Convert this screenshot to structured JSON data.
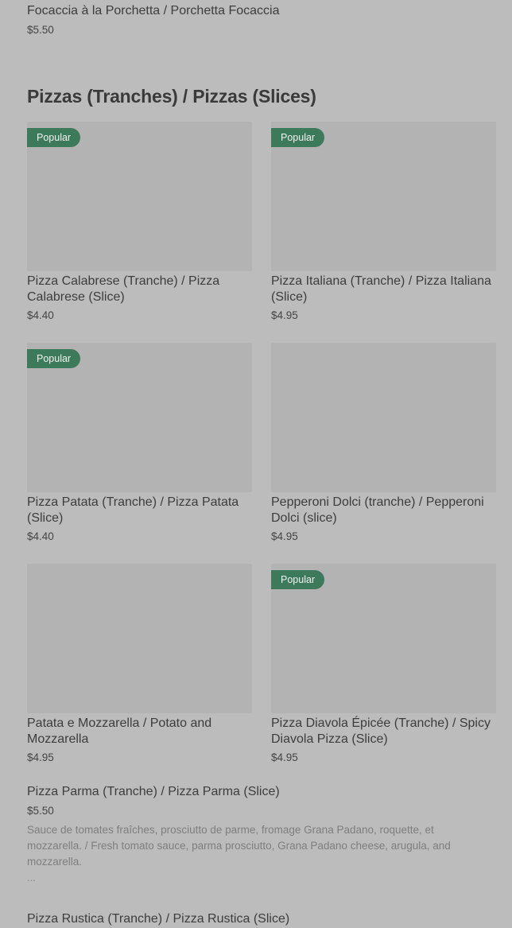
{
  "top_item": {
    "name": "Focaccia à la Porchetta / Porchetta Focaccia",
    "price": "$5.50"
  },
  "section": {
    "title": "Pizzas (Tranches) / Pizzas (Slices)"
  },
  "cards": [
    {
      "badge": "Popular",
      "name": "Pizza Calabrese (Tranche) / Pizza Calabrese (Slice)",
      "price": "$4.40"
    },
    {
      "badge": "Popular",
      "name": "Pizza Italiana  (Tranche) / Pizza Italiana (Slice)",
      "price": "$4.95"
    },
    {
      "badge": "Popular",
      "name": "Pizza Patata (Tranche) / Pizza Patata (Slice)",
      "price": "$4.40"
    },
    {
      "badge": "",
      "name": "Pepperoni Dolci (tranche) / Pepperoni Dolci (slice)",
      "price": "$4.95"
    },
    {
      "badge": "",
      "name": "Patata e Mozzarella / Potato and Mozzarella",
      "price": "$4.95"
    },
    {
      "badge": "Popular",
      "name": "Pizza Diavola Épicée (Tranche) / Spicy Diavola Pizza (Slice)",
      "price": "$4.95"
    }
  ],
  "list_items": [
    {
      "name": "Pizza Parma (Tranche) / Pizza Parma (Slice)",
      "price": "$5.50",
      "description": "Sauce de tomates fraîches, prosciutto de parme, fromage Grana Padano, roquette, et mozzarella. / Fresh tomato sauce, parma prosciutto, Grana Padano cheese, arugula, and mozzarella.",
      "more": "..."
    },
    {
      "name": "Pizza Rustica (Tranche) / Pizza Rustica (Slice)"
    }
  ]
}
